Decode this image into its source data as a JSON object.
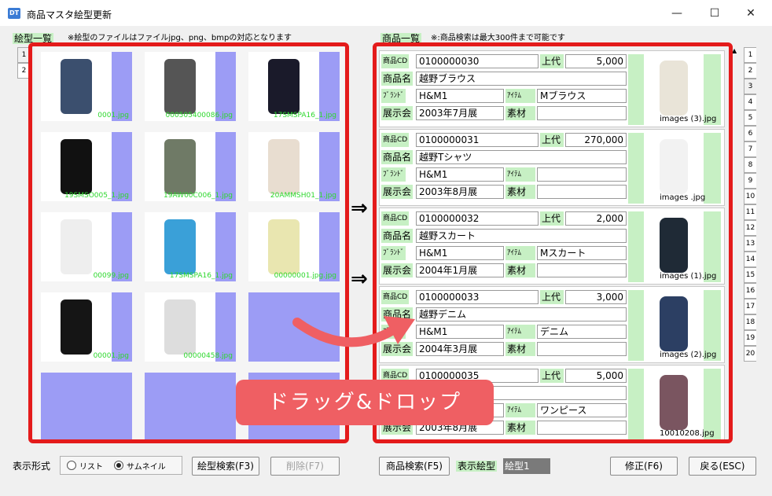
{
  "window": {
    "title": "商品マスタ絵型更新",
    "icon_text": "DT",
    "minimize": "—",
    "maximize": "☐",
    "close": "✕"
  },
  "left": {
    "label": "絵型一覧",
    "note": "※絵型のファイルはファイルjpg、png、bmpの対応となります",
    "tabs": [
      "1",
      "2"
    ],
    "thumbs": [
      {
        "cap": "0001.jpg",
        "icon": "jeans-image"
      },
      {
        "cap": "000505400086.jpg",
        "icon": "striped-shirt-image"
      },
      {
        "cap": "17SMSPA16_1.jpg",
        "icon": "black-pants-image"
      },
      {
        "cap": "19SMSO005_1.jpg",
        "icon": "black-sweater-image"
      },
      {
        "cap": "19AW00C006_1.jpg",
        "icon": "quilted-jacket-image"
      },
      {
        "cap": "20AMMSH01_1.jpg",
        "icon": "boots-image"
      },
      {
        "cap": "00099.jpg",
        "icon": "white-suit-image"
      },
      {
        "cap": "17SMSPA16_1.jpg",
        "icon": "blue-pants-image"
      },
      {
        "cap": "00000001.jpg.jpg",
        "icon": "floral-dress-image"
      },
      {
        "cap": "00001.jpg",
        "icon": "black-jacket-image"
      },
      {
        "cap": "00000458.jpg",
        "icon": "dot-skirt-image"
      },
      {
        "cap": "",
        "icon": ""
      },
      {
        "cap": "",
        "icon": ""
      },
      {
        "cap": "",
        "icon": ""
      },
      {
        "cap": "",
        "icon": ""
      }
    ]
  },
  "arrows": [
    "⇒",
    "⇒"
  ],
  "right": {
    "label": "商品一覧",
    "note": "※:商品検索は最大300件まで可能です",
    "labels": {
      "cd": "商品CD",
      "jodai": "上代",
      "name": "商品名",
      "brand": "ﾌﾞﾗﾝﾄﾞ",
      "item": "ｱｲﾃﾑ",
      "exhibit": "展示会",
      "material": "素材"
    },
    "products": [
      {
        "cd": "0100000030",
        "price": "5,000",
        "name": "越野ブラウス",
        "brand": "H&M1",
        "item": "Mブラウス",
        "exhibit": "2003年7月展",
        "material": "",
        "img": "images (3).jpg"
      },
      {
        "cd": "0100000031",
        "price": "270,000",
        "name": "越野Tシャツ",
        "brand": "H&M1",
        "item": "",
        "exhibit": "2003年8月展",
        "material": "",
        "img": "images .jpg"
      },
      {
        "cd": "0100000032",
        "price": "2,000",
        "name": "越野スカート",
        "brand": "H&M1",
        "item": "Mスカート",
        "exhibit": "2004年1月展",
        "material": "",
        "img": "images (1).jpg"
      },
      {
        "cd": "0100000033",
        "price": "3,000",
        "name": "越野デニム",
        "brand": "H&M1",
        "item": "デニム",
        "exhibit": "2004年3月展",
        "material": "",
        "img": "images (2).jpg"
      },
      {
        "cd": "0100000035",
        "price": "5,000",
        "name": "",
        "brand": "",
        "item": "ワンピース",
        "exhibit": "2003年8月展",
        "material": "",
        "img": "10010208.jpg"
      }
    ],
    "tabs": [
      "1",
      "2",
      "3",
      "4",
      "5",
      "6",
      "7",
      "8",
      "9",
      "10",
      "11",
      "12",
      "13",
      "14",
      "15",
      "16",
      "17",
      "18",
      "19",
      "20"
    ]
  },
  "callout": "ドラッグ&ドロップ",
  "footer": {
    "display_format": "表示形式",
    "list": "リスト",
    "thumbnail": "サムネイル",
    "etype_search": "絵型検索(F3)",
    "delete": "削除(F7)",
    "product_search": "商品検索(F5)",
    "display_etype_label": "表示絵型",
    "display_etype_value": "絵型1",
    "modify": "修正(F6)",
    "back": "戻る(ESC)"
  }
}
